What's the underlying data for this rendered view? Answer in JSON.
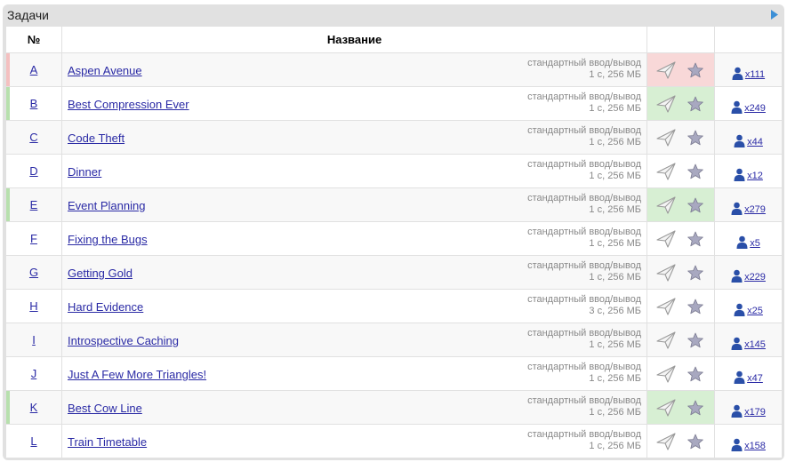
{
  "panel": {
    "title": "Задачи"
  },
  "table": {
    "header_num": "№",
    "header_name": "Название"
  },
  "colors": {
    "rejected": "#f8d8d8",
    "accepted": "#d7efd3",
    "rejected_mark": "#f4c0c0",
    "accepted_mark": "#b7e0ad",
    "link": "#2a2aa5"
  },
  "problems": [
    {
      "letter": "A",
      "name": "Aspen Avenue",
      "io": "стандартный ввод/вывод",
      "limits": "1 с, 256 МБ",
      "solved": "x111",
      "status": "rejected"
    },
    {
      "letter": "B",
      "name": "Best Compression Ever",
      "io": "стандартный ввод/вывод",
      "limits": "1 с, 256 МБ",
      "solved": "x249",
      "status": "accepted"
    },
    {
      "letter": "C",
      "name": "Code Theft",
      "io": "стандартный ввод/вывод",
      "limits": "1 с, 256 МБ",
      "solved": "x44",
      "status": "none"
    },
    {
      "letter": "D",
      "name": "Dinner",
      "io": "стандартный ввод/вывод",
      "limits": "1 с, 256 МБ",
      "solved": "x12",
      "status": "none"
    },
    {
      "letter": "E",
      "name": "Event Planning",
      "io": "стандартный ввод/вывод",
      "limits": "1 с, 256 МБ",
      "solved": "x279",
      "status": "accepted"
    },
    {
      "letter": "F",
      "name": "Fixing the Bugs",
      "io": "стандартный ввод/вывод",
      "limits": "1 с, 256 МБ",
      "solved": "x5",
      "status": "none"
    },
    {
      "letter": "G",
      "name": "Getting Gold",
      "io": "стандартный ввод/вывод",
      "limits": "1 с, 256 МБ",
      "solved": "x229",
      "status": "none"
    },
    {
      "letter": "H",
      "name": "Hard Evidence",
      "io": "стандартный ввод/вывод",
      "limits": "3 с, 256 МБ",
      "solved": "x25",
      "status": "none"
    },
    {
      "letter": "I",
      "name": "Introspective Caching",
      "io": "стандартный ввод/вывод",
      "limits": "1 с, 256 МБ",
      "solved": "x145",
      "status": "none"
    },
    {
      "letter": "J",
      "name": "Just A Few More Triangles!",
      "io": "стандартный ввод/вывод",
      "limits": "1 с, 256 МБ",
      "solved": "x47",
      "status": "none"
    },
    {
      "letter": "K",
      "name": "Best Cow Line",
      "io": "стандартный ввод/вывод",
      "limits": "1 с, 256 МБ",
      "solved": "x179",
      "status": "accepted"
    },
    {
      "letter": "L",
      "name": "Train Timetable",
      "io": "стандартный ввод/вывод",
      "limits": "1 с, 256 МБ",
      "solved": "x158",
      "status": "none"
    }
  ],
  "icons": {
    "toggle": "triangle-right-icon",
    "submit": "paper-plane-icon",
    "favorite": "star-icon",
    "solvers": "user-icon"
  }
}
